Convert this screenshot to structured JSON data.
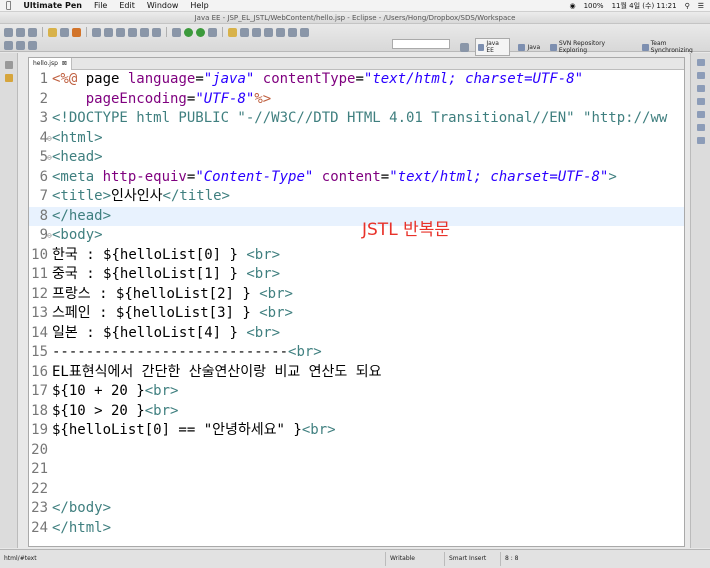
{
  "menubar": {
    "app_name": "Ultimate Pen",
    "menus": [
      "File",
      "Edit",
      "Window",
      "Help"
    ],
    "battery": "100%",
    "date": "11월 4일 (수) 11:21"
  },
  "window_title": "Java EE - JSP_EL_JSTL/WebContent/hello.jsp - Eclipse - /Users/Hong/Dropbox/SDS/Workspace",
  "perspectives": [
    {
      "label": "Java EE",
      "active": true
    },
    {
      "label": "Java",
      "active": false
    },
    {
      "label": "SVN Repository Exploring",
      "active": false
    },
    {
      "label": "Team Synchronizing",
      "active": false
    }
  ],
  "editor": {
    "tab_label": "hello.jsp",
    "tab_close": "⊠",
    "annotation": "JSTL 반복문",
    "fold_marker": "⊖",
    "lines": [
      {
        "n": "1",
        "parts": [
          [
            "dir",
            "<%@ "
          ],
          [
            "txt",
            "page "
          ],
          [
            "attr",
            "language"
          ],
          [
            "txt",
            "="
          ],
          [
            "str",
            "\"java\""
          ],
          [
            "txt",
            " "
          ],
          [
            "attr",
            "contentType"
          ],
          [
            "txt",
            "="
          ],
          [
            "str",
            "\"text/html; charset=UTF-8\""
          ]
        ]
      },
      {
        "n": "2",
        "parts": [
          [
            "txt",
            "    "
          ],
          [
            "attr",
            "pageEncoding"
          ],
          [
            "txt",
            "="
          ],
          [
            "str",
            "\"UTF-8\""
          ],
          [
            "dir",
            "%>"
          ]
        ]
      },
      {
        "n": "3",
        "parts": [
          [
            "tag",
            "<!DOCTYPE html PUBLIC \"-//W3C//DTD HTML 4.01 Transitional//EN\" \"http://ww"
          ]
        ]
      },
      {
        "n": "4",
        "fold": true,
        "parts": [
          [
            "tag",
            "<html>"
          ]
        ]
      },
      {
        "n": "5",
        "fold": true,
        "parts": [
          [
            "tag",
            "<head>"
          ]
        ]
      },
      {
        "n": "6",
        "parts": [
          [
            "tag",
            "<meta "
          ],
          [
            "attr",
            "http-equiv"
          ],
          [
            "txt",
            "="
          ],
          [
            "str",
            "\"Content-Type\""
          ],
          [
            "txt",
            " "
          ],
          [
            "attr",
            "content"
          ],
          [
            "txt",
            "="
          ],
          [
            "str",
            "\"text/html; charset=UTF-8\""
          ],
          [
            "tag",
            ">"
          ]
        ]
      },
      {
        "n": "7",
        "parts": [
          [
            "tag",
            "<title>"
          ],
          [
            "txt",
            "인사인사"
          ],
          [
            "tag",
            "</title>"
          ]
        ]
      },
      {
        "n": "8",
        "hl": true,
        "parts": [
          [
            "tag",
            "</head>"
          ]
        ]
      },
      {
        "n": "9",
        "fold": true,
        "parts": [
          [
            "tag",
            "<body>"
          ]
        ]
      },
      {
        "n": "10",
        "parts": [
          [
            "txt",
            "한국 : ${helloList[0] } "
          ],
          [
            "tag",
            "<br>"
          ]
        ]
      },
      {
        "n": "11",
        "parts": [
          [
            "txt",
            "중국 : ${helloList[1] } "
          ],
          [
            "tag",
            "<br>"
          ]
        ]
      },
      {
        "n": "12",
        "parts": [
          [
            "txt",
            "프랑스 : ${helloList[2] } "
          ],
          [
            "tag",
            "<br>"
          ]
        ]
      },
      {
        "n": "13",
        "parts": [
          [
            "txt",
            "스페인 : ${helloList[3] } "
          ],
          [
            "tag",
            "<br>"
          ]
        ]
      },
      {
        "n": "14",
        "parts": [
          [
            "txt",
            "일본 : ${helloList[4] } "
          ],
          [
            "tag",
            "<br>"
          ]
        ]
      },
      {
        "n": "15",
        "parts": [
          [
            "txt",
            "----------------------------"
          ],
          [
            "tag",
            "<br>"
          ]
        ]
      },
      {
        "n": "16",
        "parts": [
          [
            "txt",
            "EL표현식에서 간단한 산술연산이랑 비교 연산도 되요"
          ]
        ]
      },
      {
        "n": "17",
        "parts": [
          [
            "txt",
            "${10 + 20 }"
          ],
          [
            "tag",
            "<br>"
          ]
        ]
      },
      {
        "n": "18",
        "parts": [
          [
            "txt",
            "${10 > 20 }"
          ],
          [
            "tag",
            "<br>"
          ]
        ]
      },
      {
        "n": "19",
        "parts": [
          [
            "txt",
            "${helloList[0] == \"안녕하세요\" }"
          ],
          [
            "tag",
            "<br>"
          ]
        ]
      },
      {
        "n": "20",
        "parts": []
      },
      {
        "n": "21",
        "parts": []
      },
      {
        "n": "22",
        "parts": []
      },
      {
        "n": "23",
        "parts": [
          [
            "tag",
            "</body>"
          ]
        ]
      },
      {
        "n": "24",
        "parts": [
          [
            "tag",
            "</html>"
          ]
        ]
      }
    ]
  },
  "statusbar": {
    "path": "html/#text",
    "mode": "Writable",
    "insert": "Smart Insert",
    "position": "8 : 8"
  }
}
